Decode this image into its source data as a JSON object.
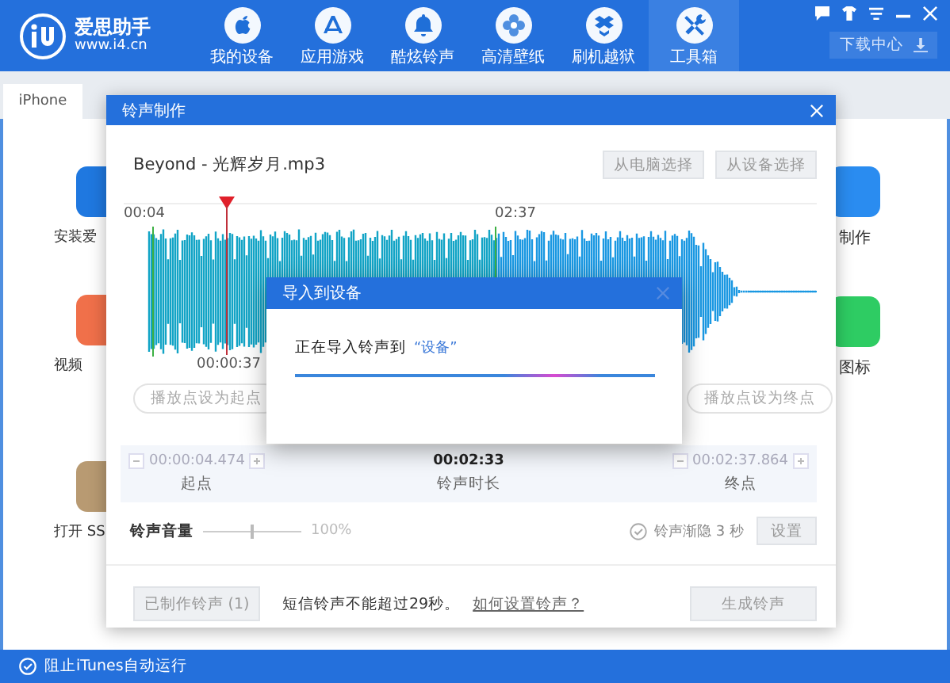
{
  "app": {
    "name": "爱思助手",
    "url": "www.i4.cn"
  },
  "window_controls": [
    {
      "kind": "feedback"
    },
    {
      "kind": "skin"
    },
    {
      "kind": "menu"
    },
    {
      "kind": "minimize"
    },
    {
      "kind": "close"
    }
  ],
  "nav": [
    {
      "label": "我的设备",
      "kind": "apple",
      "selected": false
    },
    {
      "label": "应用游戏",
      "kind": "apps",
      "selected": false
    },
    {
      "label": "酷炫铃声",
      "kind": "bell",
      "selected": false
    },
    {
      "label": "高清壁纸",
      "kind": "flower",
      "selected": false
    },
    {
      "label": "刷机越狱",
      "kind": "box",
      "selected": false
    },
    {
      "label": "工具箱",
      "kind": "tools",
      "selected": true
    }
  ],
  "download_button": "下载中心",
  "device_tabs": [
    {
      "label": "iPhone",
      "selected": true
    }
  ],
  "tools_left": [
    {
      "label": "安装爱",
      "color": "#1f78e0"
    },
    {
      "label": "视频",
      "color": "#f0704a"
    },
    {
      "label": "打开 SS",
      "color": "#b89a72"
    }
  ],
  "tools_right": [
    {
      "label": "制作",
      "color": "#2a8cf0"
    },
    {
      "label": "图标",
      "color": "#2ecc63"
    }
  ],
  "ringtone_dialog": {
    "title": "铃声制作",
    "file": "Beyond - 光辉岁月.mp3",
    "source_buttons": [
      "从电脑选择",
      "从设备选择"
    ],
    "start_label": "00:04",
    "end_label": "02:37",
    "playhead_time": "00:00:37",
    "set_start_button": "播放点设为起点",
    "set_end_button": "播放点设为终点",
    "start": {
      "value": "00:00:04.474",
      "caption": "起点"
    },
    "duration": {
      "value": "00:02:33",
      "caption": "铃声时长"
    },
    "end": {
      "value": "00:02:37.864",
      "caption": "终点"
    },
    "volume": {
      "label": "铃声音量",
      "level": 0.5,
      "reading": "100%"
    },
    "fade": {
      "label": "铃声渐隐 3 秒",
      "checked": false,
      "button": "设置"
    },
    "made_button": "已制作铃声 (1)",
    "note": "短信铃声不能超过29秒。",
    "help_link": "如何设置铃声？",
    "generate_button": "生成铃声"
  },
  "import_dialog": {
    "title": "导入到设备",
    "message": "正在导入铃声到",
    "target": "“设备”",
    "level": 1
  },
  "status_bar": {
    "label": "阻止iTunes自动运行"
  }
}
